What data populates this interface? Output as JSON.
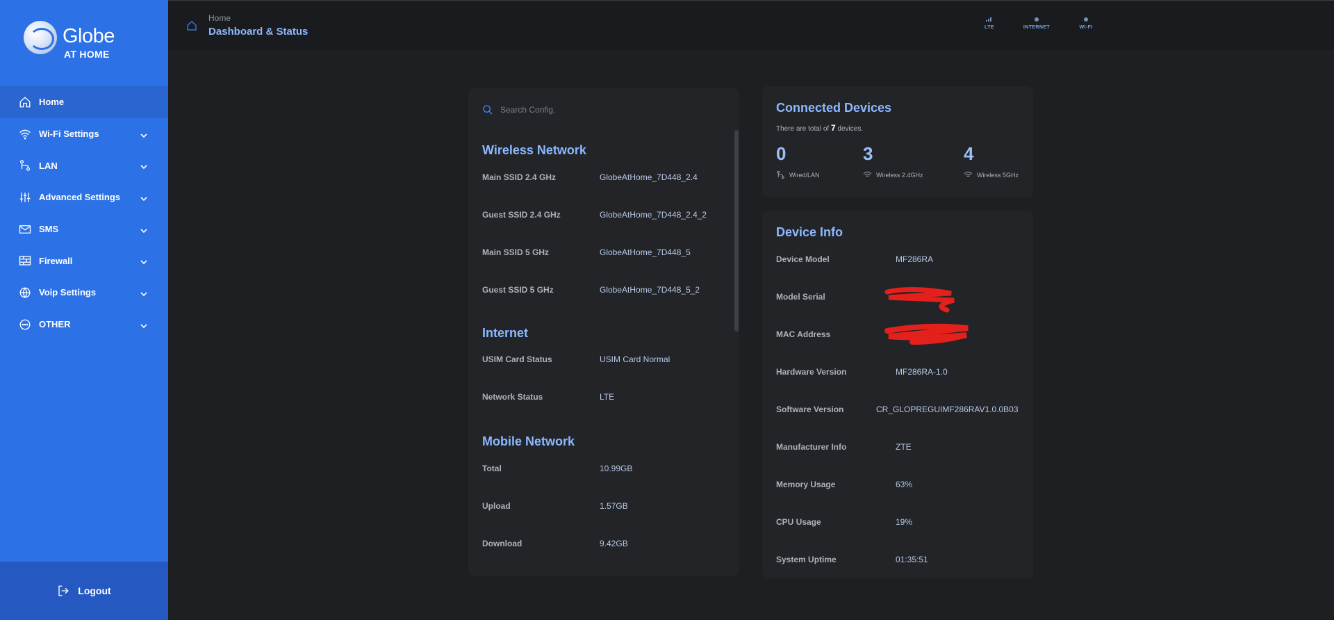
{
  "sidebar": {
    "brand": "Globe",
    "brand_sub": "AT HOME",
    "items": [
      {
        "label": "Home"
      },
      {
        "label": "Wi-Fi Settings"
      },
      {
        "label": "LAN"
      },
      {
        "label": "Advanced Settings"
      },
      {
        "label": "SMS"
      },
      {
        "label": "Firewall"
      },
      {
        "label": "Voip Settings"
      },
      {
        "label": "OTHER"
      }
    ],
    "logout": "Logout"
  },
  "header": {
    "breadcrumb": "Home",
    "title": "Dashboard & Status",
    "indicators": {
      "lte": "LTE",
      "internet": "INTERNET",
      "wifi": "WI-FI"
    }
  },
  "search": {
    "placeholder": "Search Config."
  },
  "wireless": {
    "title": "Wireless Network",
    "rows": [
      {
        "k": "Main SSID 2.4 GHz",
        "v": "GlobeAtHome_7D448_2.4"
      },
      {
        "k": "Guest SSID 2.4 GHz",
        "v": "GlobeAtHome_7D448_2.4_2"
      },
      {
        "k": "Main SSID 5 GHz",
        "v": "GlobeAtHome_7D448_5"
      },
      {
        "k": "Guest SSID 5 GHz",
        "v": "GlobeAtHome_7D448_5_2"
      }
    ]
  },
  "internet": {
    "title": "Internet",
    "rows": [
      {
        "k": "USIM Card Status",
        "v": "USIM Card Normal"
      },
      {
        "k": "Network Status",
        "v": "LTE"
      }
    ]
  },
  "mobile": {
    "title": "Mobile Network",
    "rows": [
      {
        "k": "Total",
        "v": "10.99GB"
      },
      {
        "k": "Upload",
        "v": "1.57GB"
      },
      {
        "k": "Download",
        "v": "9.42GB"
      }
    ]
  },
  "connected": {
    "title": "Connected Devices",
    "sub_pre": "There are total of",
    "total": "7",
    "sub_post": "devices.",
    "wired": {
      "count": "0",
      "label": "Wired/LAN"
    },
    "w24": {
      "count": "3",
      "label": "Wireless 2.4GHz"
    },
    "w5": {
      "count": "4",
      "label": "Wireless 5GHz"
    }
  },
  "device": {
    "title": "Device Info",
    "rows": [
      {
        "k": "Device Model",
        "v": "MF286RA"
      },
      {
        "k": "Model Serial",
        "v": ""
      },
      {
        "k": "MAC Address",
        "v": ""
      },
      {
        "k": "Hardware Version",
        "v": "MF286RA-1.0"
      },
      {
        "k": "Software Version",
        "v": "CR_GLOPREGUIMF286RAV1.0.0B03"
      },
      {
        "k": "Manufacturer Info",
        "v": "ZTE"
      },
      {
        "k": "Memory Usage",
        "v": "63%"
      },
      {
        "k": "CPU Usage",
        "v": "19%"
      },
      {
        "k": "System Uptime",
        "v": "01:35:51"
      }
    ]
  },
  "colors": {
    "sidebar": "#2c72e6",
    "accent": "#8cb8ff",
    "background": "#1d1f22",
    "redaction": "#e3201b"
  }
}
